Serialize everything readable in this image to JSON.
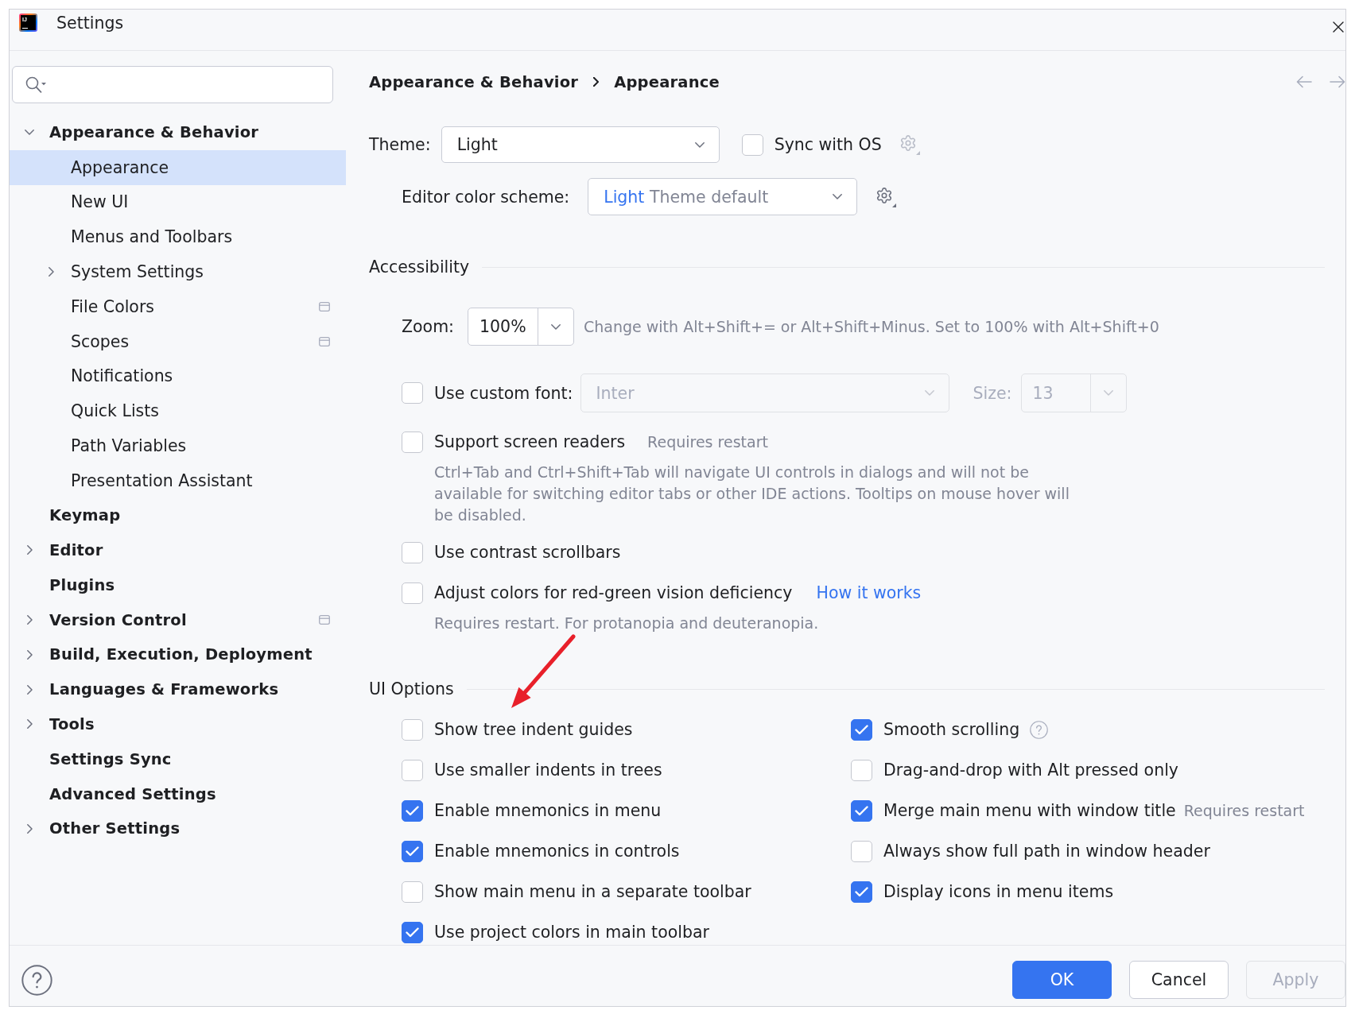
{
  "window": {
    "title": "Settings",
    "logo": "IJ"
  },
  "sidebar": {
    "items": [
      {
        "label": "Appearance & Behavior",
        "selected": false,
        "expandable": true,
        "expanded": true,
        "project_scope": false,
        "children": [
          {
            "label": "Appearance",
            "selected": true,
            "expandable": false,
            "expanded": false,
            "project_scope": false
          },
          {
            "label": "New UI",
            "selected": false,
            "expandable": false,
            "expanded": false,
            "project_scope": false
          },
          {
            "label": "Menus and Toolbars",
            "selected": false,
            "expandable": false,
            "expanded": false,
            "project_scope": false
          },
          {
            "label": "System Settings",
            "selected": false,
            "expandable": true,
            "expanded": false,
            "project_scope": false
          },
          {
            "label": "File Colors",
            "selected": false,
            "expandable": false,
            "expanded": false,
            "project_scope": true
          },
          {
            "label": "Scopes",
            "selected": false,
            "expandable": false,
            "expanded": false,
            "project_scope": true
          },
          {
            "label": "Notifications",
            "selected": false,
            "expandable": false,
            "expanded": false,
            "project_scope": false
          },
          {
            "label": "Quick Lists",
            "selected": false,
            "expandable": false,
            "expanded": false,
            "project_scope": false
          },
          {
            "label": "Path Variables",
            "selected": false,
            "expandable": false,
            "expanded": false,
            "project_scope": false
          },
          {
            "label": "Presentation Assistant",
            "selected": false,
            "expandable": false,
            "expanded": false,
            "project_scope": false
          }
        ]
      },
      {
        "label": "Keymap",
        "selected": false,
        "expandable": false,
        "expanded": false,
        "project_scope": false
      },
      {
        "label": "Editor",
        "selected": false,
        "expandable": true,
        "expanded": false,
        "project_scope": false
      },
      {
        "label": "Plugins",
        "selected": false,
        "expandable": false,
        "expanded": false,
        "project_scope": false
      },
      {
        "label": "Version Control",
        "selected": false,
        "expandable": true,
        "expanded": false,
        "project_scope": true
      },
      {
        "label": "Build, Execution, Deployment",
        "selected": false,
        "expandable": true,
        "expanded": false,
        "project_scope": false
      },
      {
        "label": "Languages & Frameworks",
        "selected": false,
        "expandable": true,
        "expanded": false,
        "project_scope": false
      },
      {
        "label": "Tools",
        "selected": false,
        "expandable": true,
        "expanded": false,
        "project_scope": false
      },
      {
        "label": "Settings Sync",
        "selected": false,
        "expandable": false,
        "expanded": false,
        "project_scope": false
      },
      {
        "label": "Advanced Settings",
        "selected": false,
        "expandable": false,
        "expanded": false,
        "project_scope": false
      },
      {
        "label": "Other Settings",
        "selected": false,
        "expandable": true,
        "expanded": false,
        "project_scope": false
      }
    ]
  },
  "breadcrumb": [
    "Appearance & Behavior",
    "Appearance"
  ],
  "theme": {
    "label": "Theme:",
    "value": "Light",
    "sync": {
      "label": "Sync with OS",
      "checked": false
    }
  },
  "editor_color_scheme": {
    "label": "Editor color scheme:",
    "value": "Light",
    "suffix": "Theme default"
  },
  "accessibility": {
    "title": "Accessibility",
    "zoom": {
      "label": "Zoom:",
      "value": "100%",
      "hint": "Change with Alt+Shift+= or Alt+Shift+Minus. Set to 100% with Alt+Shift+0"
    },
    "options": [
      {
        "kind": "font",
        "label": "Use custom font:",
        "checked": false,
        "font": {
          "value": "Inter",
          "disabled": true
        },
        "size": {
          "label": "Size:",
          "value": "13",
          "disabled": true
        }
      },
      {
        "kind": "plain",
        "label": "Support screen readers",
        "checked": false,
        "note": "Requires restart",
        "description": "Ctrl+Tab and Ctrl+Shift+Tab will navigate UI controls in dialogs and will not be available for switching editor tabs or other IDE actions. Tooltips on mouse hover will be disabled."
      },
      {
        "kind": "plain",
        "label": "Use contrast scrollbars",
        "checked": false
      },
      {
        "kind": "plain",
        "label": "Adjust colors for red-green vision deficiency",
        "checked": false,
        "link": "How it works",
        "description": "Requires restart. For protanopia and deuteranopia."
      }
    ]
  },
  "ui_options": {
    "title": "UI Options",
    "columns": [
      [
        {
          "label": "Show tree indent guides",
          "checked": false
        },
        {
          "label": "Use smaller indents in trees",
          "checked": false
        },
        {
          "label": "Enable mnemonics in menu",
          "checked": true
        },
        {
          "label": "Enable mnemonics in controls",
          "checked": true
        },
        {
          "label": "Show main menu in a separate toolbar",
          "checked": false
        },
        {
          "label": "Use project colors in main toolbar",
          "checked": true
        }
      ],
      [
        {
          "label": "Smooth scrolling",
          "checked": true,
          "help": true
        },
        {
          "label": "Drag-and-drop with Alt pressed only",
          "checked": false
        },
        {
          "label": "Merge main menu with window title",
          "checked": true,
          "note": "Requires restart"
        },
        {
          "label": "Always show full path in window header",
          "checked": false
        },
        {
          "label": "Display icons in menu items",
          "checked": true
        }
      ]
    ]
  },
  "footer": {
    "buttons": [
      {
        "label": "OK",
        "kind": "primary",
        "disabled": false
      },
      {
        "label": "Cancel",
        "kind": "secondary",
        "disabled": false
      },
      {
        "label": "Apply",
        "kind": "secondary",
        "disabled": true
      }
    ]
  }
}
